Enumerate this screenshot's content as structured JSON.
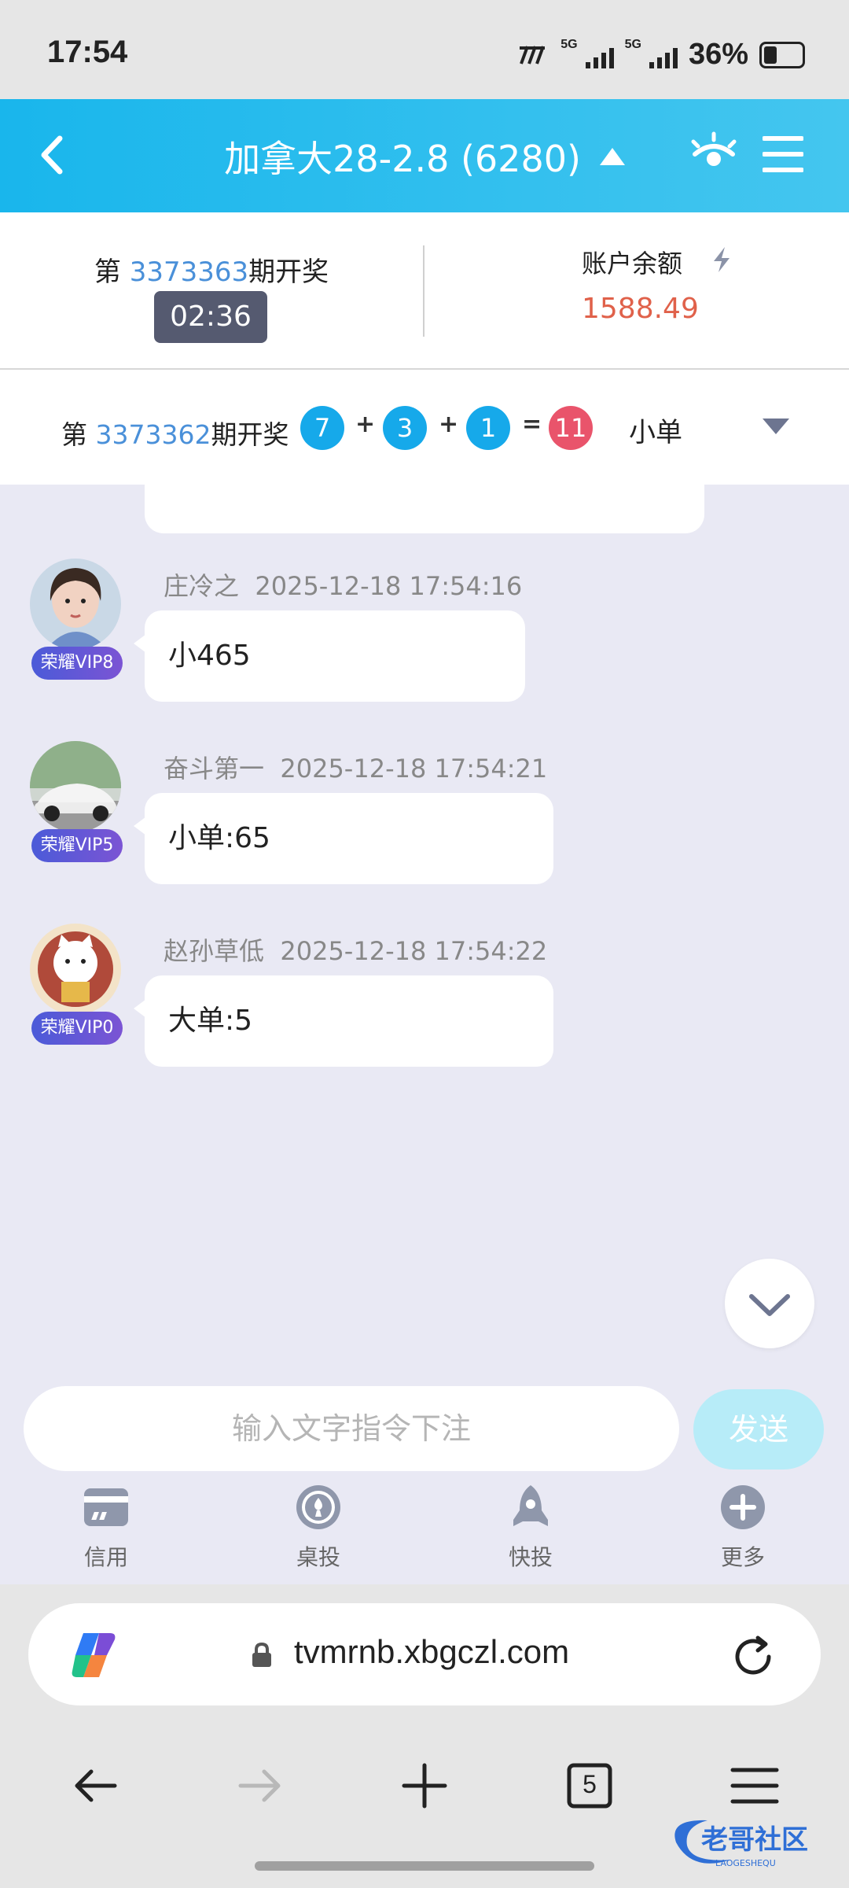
{
  "status_bar": {
    "time": "17:54",
    "network_1": "5G",
    "network_2": "5G",
    "battery": "36%"
  },
  "header": {
    "title": "加拿大28-2.8 (6280)"
  },
  "draw_panel": {
    "period_prefix": "第 ",
    "period_number": "3373363",
    "period_suffix": "期开奖",
    "countdown": "02:36",
    "balance_label": "账户余额",
    "balance_value": "1588.49"
  },
  "last_result": {
    "period_prefix": "第 ",
    "period_number": "3373362",
    "period_suffix": "期开奖",
    "balls": [
      "7",
      "3",
      "1"
    ],
    "plus": "+",
    "equals": "=",
    "sum": "11",
    "tag": "小单"
  },
  "messages": [
    {
      "user": "庄冷之",
      "time": "2025-12-18 17:54:16",
      "vip": "荣耀VIP8",
      "text": "小465"
    },
    {
      "user": "奋斗第一",
      "time": "2025-12-18 17:54:21",
      "vip": "荣耀VIP5",
      "text": "小单:65"
    },
    {
      "user": "赵孙草低",
      "time": "2025-12-18 17:54:22",
      "vip": "荣耀VIP0",
      "text": "大单:5"
    }
  ],
  "input": {
    "placeholder": "输入文字指令下注",
    "send_label": "发送"
  },
  "toolbar": [
    {
      "label": "信用",
      "icon": "credit-card-icon"
    },
    {
      "label": "桌投",
      "icon": "spade-icon"
    },
    {
      "label": "快投",
      "icon": "rocket-icon"
    },
    {
      "label": "更多",
      "icon": "plus-circle-icon"
    }
  ],
  "browser": {
    "url": "tvmrnb.xbgczl.com",
    "tab_count": "5"
  },
  "watermark": {
    "text": "老哥社区",
    "subtext": "LAOGESHEQU"
  },
  "colors": {
    "header": "#19b6ec",
    "accent_blue": "#4a90d9",
    "balance": "#e0614a",
    "ball_blue": "#16a9ea",
    "ball_red": "#e9546b",
    "send_disabled": "#b7ecf8"
  }
}
